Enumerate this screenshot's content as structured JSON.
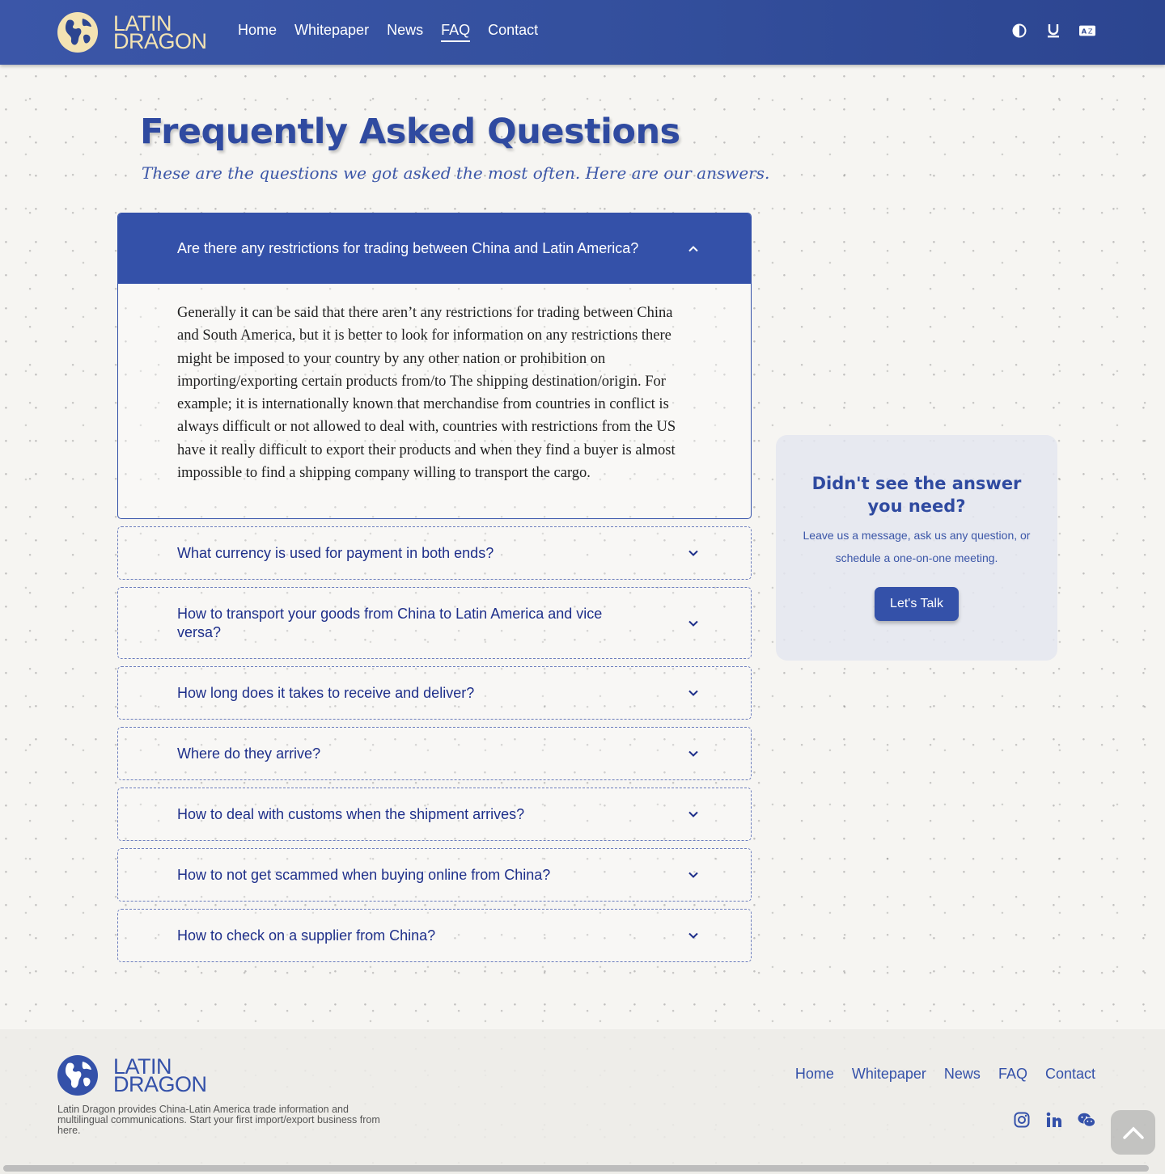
{
  "brand": {
    "line1": "LATIN",
    "line2": "DRAGON"
  },
  "nav": [
    {
      "label": "Home"
    },
    {
      "label": "Whitepaper"
    },
    {
      "label": "News"
    },
    {
      "label": "FAQ",
      "active": true
    },
    {
      "label": "Contact"
    }
  ],
  "tools": [
    "contrast-icon",
    "underline-icon",
    "translate-icon"
  ],
  "page": {
    "title": "Frequently Asked Questions",
    "subtitle": "These are the questions we got asked the most often. Here are our answers."
  },
  "faq": [
    {
      "question": "Are there any restrictions for trading between China and Latin America?",
      "answer": "Generally it can be said that there aren’t any restrictions for trading between China and South America, but it is better to look for information on any restrictions there might be imposed to your country by any other nation or prohibition on importing/exporting certain products from/to The shipping destination/origin. For example; it is internationally known that merchandise from countries in conflict is always difficult or not allowed to deal with, countries with restrictions from the US have it really difficult to export their products and when they find a buyer is almost impossible to find a shipping company willing to transport the cargo.",
      "open": true
    },
    {
      "question": "What currency is used for payment in both ends?"
    },
    {
      "question": "How to transport your goods from China to Latin America and vice versa?"
    },
    {
      "question": "How long does it takes to receive and deliver?"
    },
    {
      "question": "Where do they arrive?"
    },
    {
      "question": "How to deal with customs when the shipment arrives?"
    },
    {
      "question": "How to not get scammed when buying online from China?"
    },
    {
      "question": "How to check on a supplier from China?"
    }
  ],
  "cta": {
    "heading": "Didn't see the answer you need?",
    "text": "Leave us a message, ask us any question, or schedule a one-on-one meeting.",
    "button": "Let's Talk"
  },
  "footer": {
    "description": "Latin Dragon provides China-Latin America trade information and multilingual communications. Start your first import/export business from here.",
    "nav": [
      "Home",
      "Whitepaper",
      "News",
      "FAQ",
      "Contact"
    ],
    "social": [
      "instagram-icon",
      "linkedin-icon",
      "wechat-icon"
    ]
  },
  "colors": {
    "primary": "#3451a9",
    "header_gradient": [
      "#3b56a8",
      "#2c4590"
    ],
    "logo_accent": "#f3e3b3",
    "background": "#f6f5f2"
  }
}
